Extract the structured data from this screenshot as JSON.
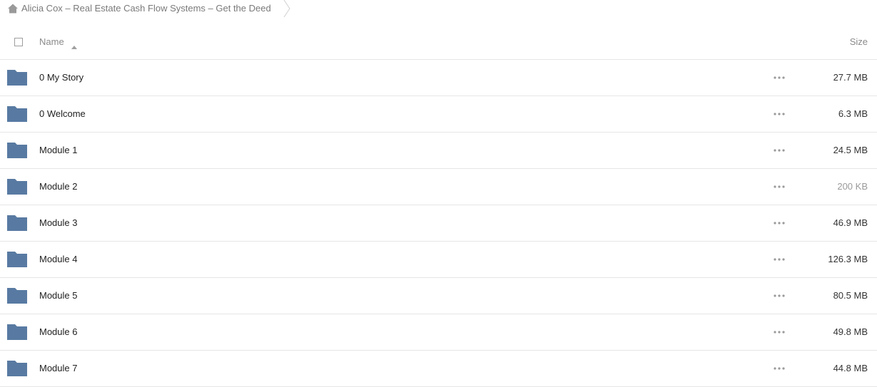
{
  "breadcrumb": {
    "home_icon": "home-icon",
    "path": "Alicia Cox – Real Estate Cash Flow Systems – Get the Deed"
  },
  "header": {
    "name_label": "Name",
    "size_label": "Size",
    "sort_icon": "sort-ascending-icon"
  },
  "colors": {
    "folder": "#587aa2",
    "divider": "#e6e6e6",
    "muted_text": "#8a8a8a"
  },
  "files": [
    {
      "name": "0 My Story",
      "size": "27.7 MB",
      "icon": "folder-icon",
      "actions_icon": "more-icon"
    },
    {
      "name": "0 Welcome",
      "size": "6.3 MB",
      "icon": "folder-icon",
      "actions_icon": "more-icon"
    },
    {
      "name": "Module 1",
      "size": "24.5 MB",
      "icon": "folder-icon",
      "actions_icon": "more-icon"
    },
    {
      "name": "Module 2",
      "size": "200 KB",
      "icon": "folder-icon",
      "actions_icon": "more-icon"
    },
    {
      "name": "Module 3",
      "size": "46.9 MB",
      "icon": "folder-icon",
      "actions_icon": "more-icon"
    },
    {
      "name": "Module 4",
      "size": "126.3 MB",
      "icon": "folder-icon",
      "actions_icon": "more-icon"
    },
    {
      "name": "Module 5",
      "size": "80.5 MB",
      "icon": "folder-icon",
      "actions_icon": "more-icon"
    },
    {
      "name": "Module 6",
      "size": "49.8 MB",
      "icon": "folder-icon",
      "actions_icon": "more-icon"
    },
    {
      "name": "Module 7",
      "size": "44.8 MB",
      "icon": "folder-icon",
      "actions_icon": "more-icon"
    }
  ]
}
